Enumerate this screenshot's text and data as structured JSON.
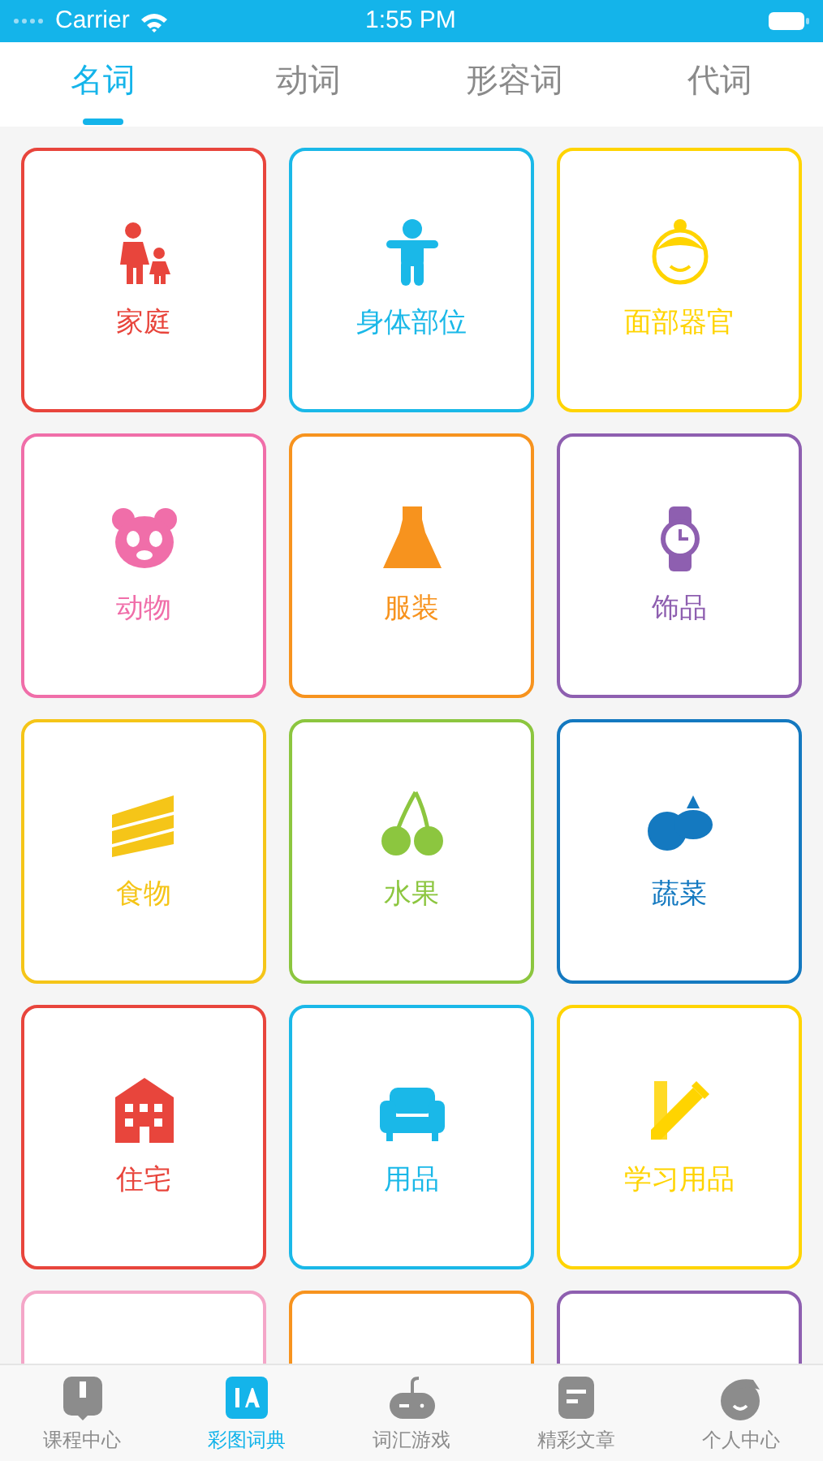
{
  "status_bar": {
    "carrier": "Carrier",
    "time": "1:55 PM"
  },
  "tabs": [
    {
      "label": "名词",
      "selected": true
    },
    {
      "label": "动词",
      "selected": false
    },
    {
      "label": "形容词",
      "selected": false
    },
    {
      "label": "代词",
      "selected": false
    }
  ],
  "cards": [
    {
      "label": "家庭",
      "color": "#e8453c"
    },
    {
      "label": "身体部位",
      "color": "#1ab8e8"
    },
    {
      "label": "面部器官",
      "color": "#ffd400"
    },
    {
      "label": "动物",
      "color": "#f06ea9"
    },
    {
      "label": "服装",
      "color": "#f7931e"
    },
    {
      "label": "饰品",
      "color": "#8e5fb0"
    },
    {
      "label": "食物",
      "color": "#f5c518"
    },
    {
      "label": "水果",
      "color": "#8cc63f"
    },
    {
      "label": "蔬菜",
      "color": "#1479c0"
    },
    {
      "label": "住宅",
      "color": "#e8453c"
    },
    {
      "label": "用品",
      "color": "#1ab8e8"
    },
    {
      "label": "学习用品",
      "color": "#ffd400"
    },
    {
      "color": "#f4a6c8"
    },
    {
      "color": "#f7931e"
    },
    {
      "color": "#8e5fb0"
    }
  ],
  "bottom_tabs": [
    {
      "label": "课程中心",
      "selected": false
    },
    {
      "label": "彩图词典",
      "selected": true
    },
    {
      "label": "词汇游戏",
      "selected": false
    },
    {
      "label": "精彩文章",
      "selected": false
    },
    {
      "label": "个人中心",
      "selected": false
    }
  ]
}
